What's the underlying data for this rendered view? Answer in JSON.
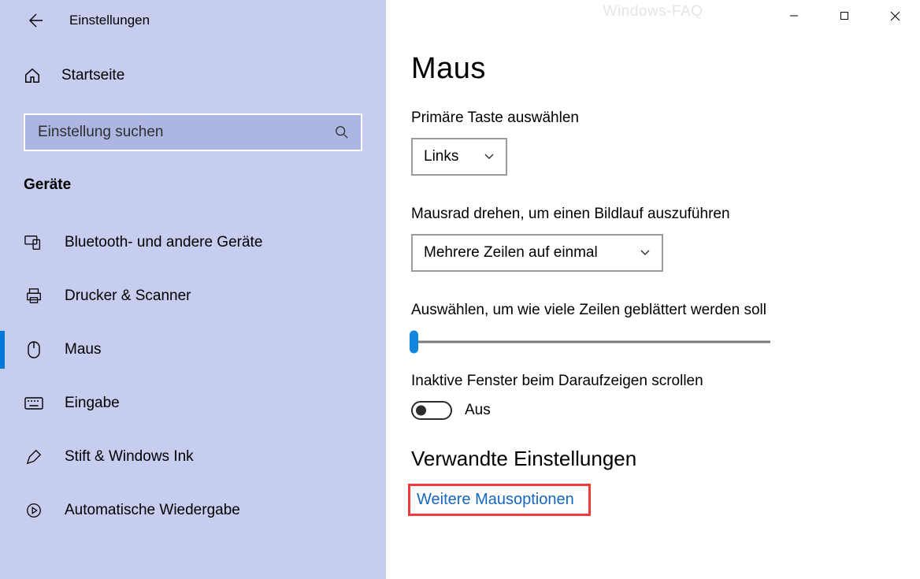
{
  "watermark": "Windows-FAQ",
  "sidebar": {
    "title": "Einstellungen",
    "home_label": "Startseite",
    "search_placeholder": "Einstellung suchen",
    "section_title": "Geräte",
    "items": [
      {
        "label": "Bluetooth- und andere Geräte"
      },
      {
        "label": "Drucker & Scanner"
      },
      {
        "label": "Maus"
      },
      {
        "label": "Eingabe"
      },
      {
        "label": "Stift & Windows Ink"
      },
      {
        "label": "Automatische Wiedergabe"
      }
    ]
  },
  "main": {
    "page_title": "Maus",
    "primary_button": {
      "label": "Primäre Taste auswählen",
      "value": "Links"
    },
    "wheel_scroll": {
      "label": "Mausrad drehen, um einen Bildlauf auszuführen",
      "value": "Mehrere Zeilen auf einmal"
    },
    "lines": {
      "label": "Auswählen, um wie viele Zeilen geblättert werden soll"
    },
    "inactive": {
      "label": "Inaktive Fenster beim Daraufzeigen scrollen",
      "state_text": "Aus"
    },
    "related": {
      "title": "Verwandte Einstellungen",
      "link": "Weitere Mausoptionen"
    }
  }
}
